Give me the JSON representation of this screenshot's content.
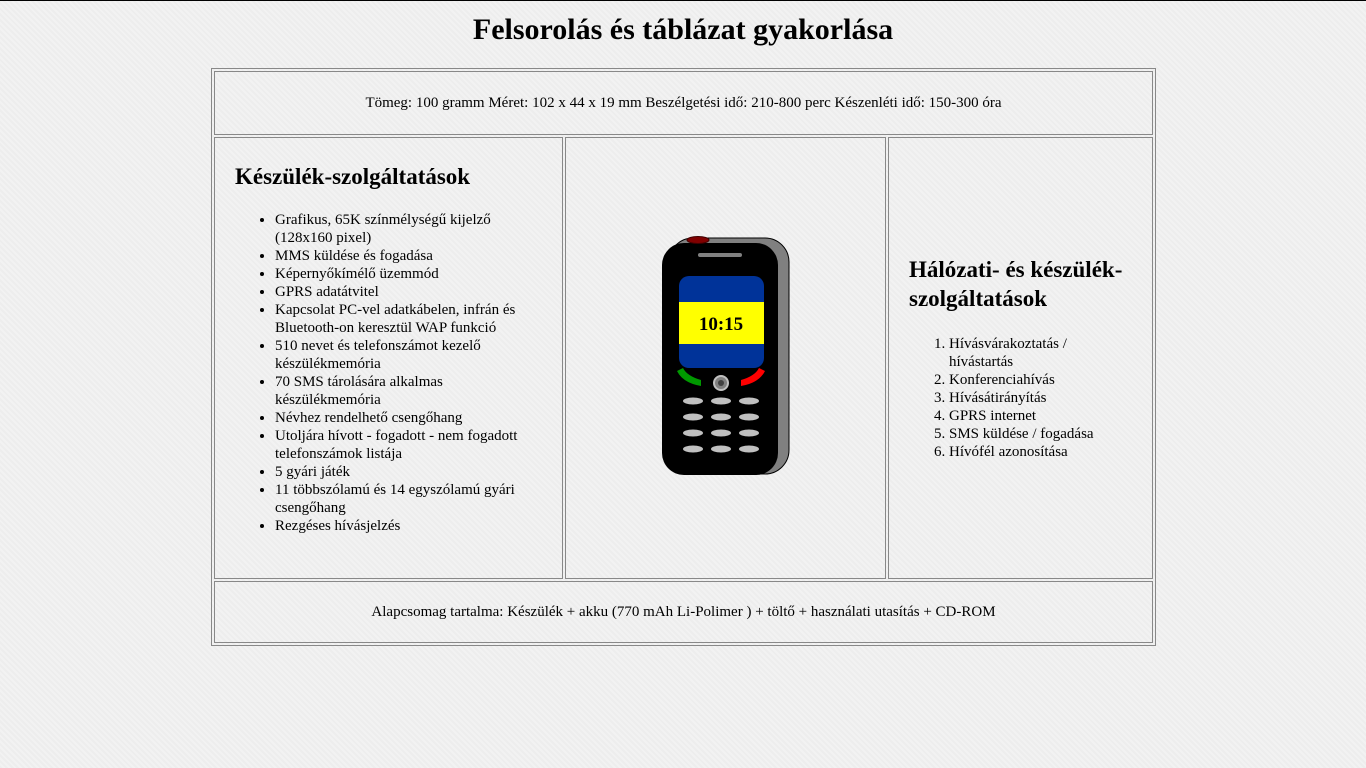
{
  "page": {
    "title": "Felsorolás és táblázat gyakorlása"
  },
  "specs": "Tömeg: 100 gramm Méret: 102 x 44 x 19 mm Beszélgetési idő: 210-800 perc Készenléti idő: 150-300 óra",
  "device_services": {
    "heading": "Készülék-szolgáltatások",
    "items": [
      "Grafikus, 65K színmélységű kijelző (128x160 pixel)",
      "MMS küldése és fogadása",
      "Képernyőkímélő üzemmód",
      "GPRS adatátvitel",
      "Kapcsolat PC-vel adatkábelen, infrán és Bluetooth-on keresztül WAP funkció",
      "510 nevet és telefonszámot kezelő készülékmemória",
      "70 SMS tárolására alkalmas készülékmemória",
      "Névhez rendelhető csengőhang",
      "Utoljára hívott - fogadott - nem fogadott telefonszámok listája",
      "5 gyári játék",
      "11 többszólamú és 14 egyszólamú gyári csengőhang",
      "Rezgéses hívásjelzés"
    ]
  },
  "phone": {
    "clock": "10:15",
    "colors": {
      "body": "#000000",
      "screen_band": "#003399",
      "screen_center": "#ffff00",
      "call_button": "#009900",
      "end_button": "#ff0000",
      "top_button": "#800000",
      "keys": "#c0c0c0"
    }
  },
  "network_services": {
    "heading": "Hálózati- és készülék-szolgáltatások",
    "items": [
      "Hívásvárakoztatás / hívástartás",
      "Konferenciahívás",
      "Hívásátirányítás",
      "GPRS internet",
      "SMS küldése / fogadása",
      "Hívófél azonosítása"
    ]
  },
  "package": "Alapcsomag tartalma: Készülék + akku (770 mAh Li-Polimer ) + töltő + használati utasítás + CD-ROM"
}
